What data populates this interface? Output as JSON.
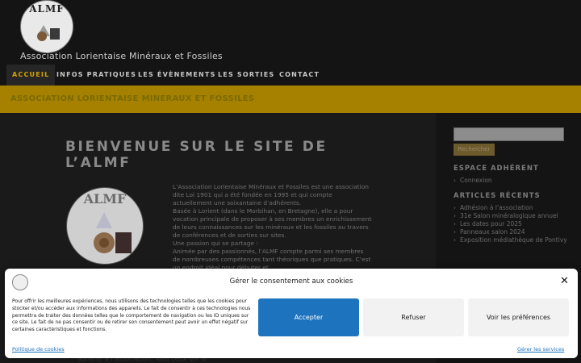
{
  "header": {
    "logo_text": "ALMF",
    "tagline": "Association Lorientaise Minéraux et Fossiles"
  },
  "nav": {
    "items": [
      "ACCUEIL",
      "INFOS PRATIQUES",
      "LES ÉVÈNEMENTS",
      "LES SORTIES",
      "CONTACT"
    ]
  },
  "banner": {
    "title": "ASSOCIATION LORIENTAISE MINERAUX ET FOSSILES"
  },
  "main": {
    "heading": "BIENVENUE SUR LE SITE DE L’ALMF",
    "image_text": "ALMF",
    "paragraphs": [
      "L’Association Lorientaise Minéraux et Fossiles est une association dite Loi 1901 qui a été fondée en 1995 et qui compte actuellement une soixantaine d’adhérents.",
      "Basée à Lorient (dans le Morbihan, en Bretagne), elle a pour vocation principale de proposer à ses membres un enrichissement de leurs connaissances sur les minéraux et les fossiles au travers de conférences et de sorties sur sites.",
      "Une passion qui se partage :",
      "Animée par des passionnés, l’ALMF compte parmi ses membres de nombreuses compétences tant théoriques que pratiques. C’est un endroit idéal pour débuter et"
    ],
    "bottom_text": "adhérer à l’association. Tous ceux qui le"
  },
  "sidebar": {
    "search_button": "Rechercher",
    "member_title": "ESPACE ADHÉRENT",
    "member_links": [
      "Connexion"
    ],
    "recent_title": "ARTICLES RÉCENTS",
    "recent_links": [
      "Adhésion à l’association",
      "31e Salon minéralogique annuel",
      "Les dates pour 2025",
      "Panneaux salon 2024",
      "Exposition médiathèque de Pontivy"
    ]
  },
  "cookie": {
    "title": "Gérer le consentement aux cookies",
    "text": "Pour offrir les meilleures expériences, nous utilisons des technologies telles que les cookies pour stocker et/ou accéder aux informations des appareils. Le fait de consentir à ces technologies nous permettra de traiter des données telles que le comportement de navigation ou les ID uniques sur ce site. Le fait de ne pas consentir ou de retirer son consentement peut avoir un effet négatif sur certaines caractéristiques et fonctions.",
    "accept": "Accepter",
    "refuse": "Refuser",
    "preferences": "Voir les préférences",
    "policy_link": "Politique de cookies",
    "services_link": "Gérer les services"
  },
  "colors": {
    "accent": "#d6a200",
    "banner": "#a68100",
    "accept_button": "#1e73be"
  }
}
